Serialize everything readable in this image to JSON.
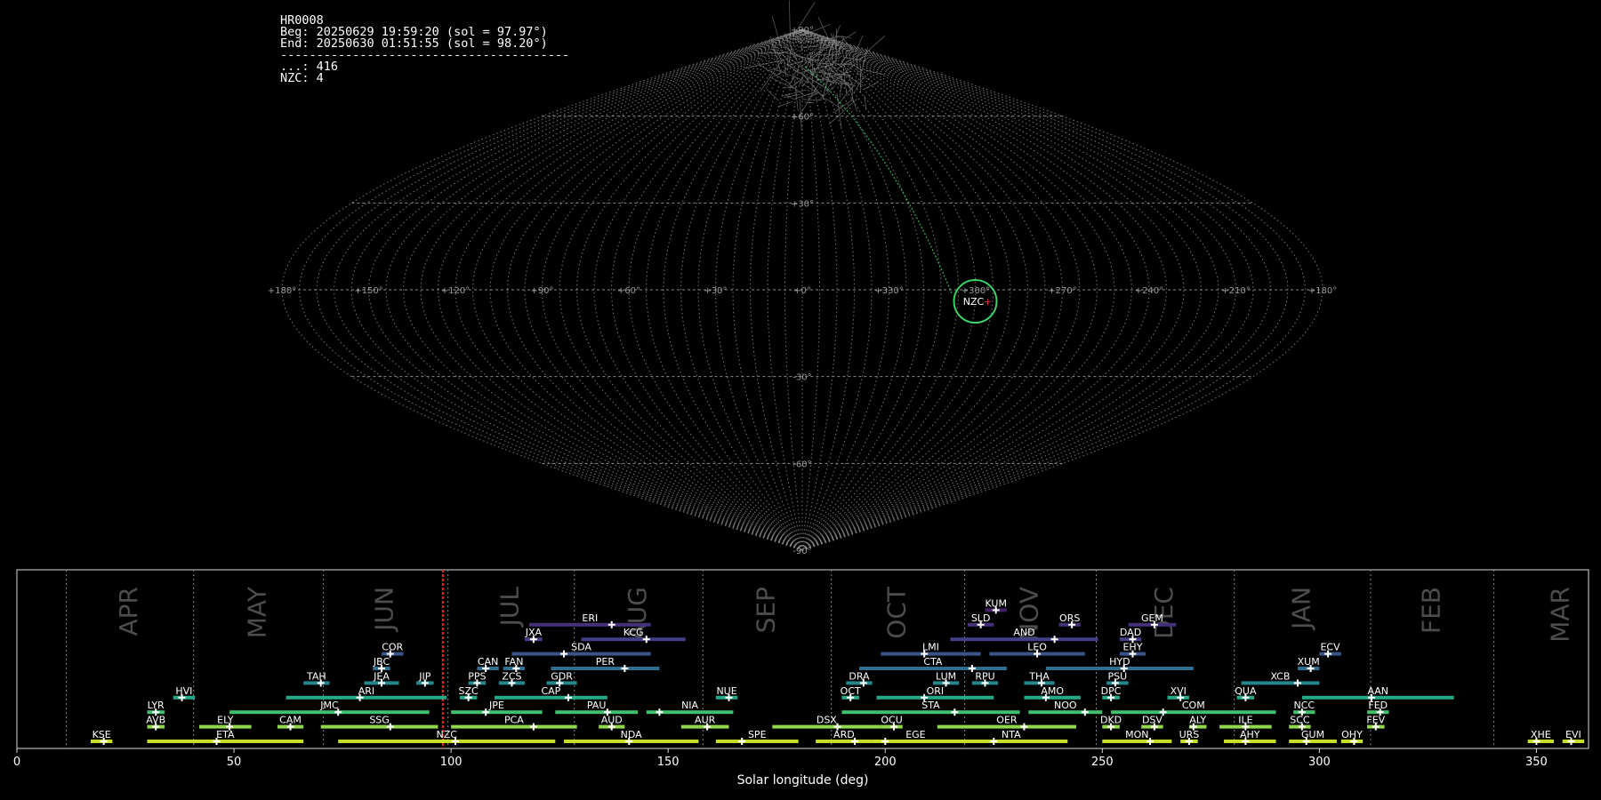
{
  "info": {
    "station": "HR0008",
    "begin": "Beg: 20250629 19:59:20 (sol = 97.97°)",
    "end": "End: 20250630 01:51:55 (sol = 98.20°)",
    "divider": "----------------------------------------",
    "count_line": "...: 416",
    "nzc_line": "NZC: 4"
  },
  "chart_data": [
    {
      "type": "scatter",
      "name": "sky-map",
      "projection": "sinusoidal",
      "lon_labels": [
        "+180°",
        "+150°",
        "+120°",
        "+90°",
        "+60°",
        "+30°",
        "+0°",
        "+330°",
        "+300°",
        "+270°",
        "+240°",
        "+210°",
        "+180°"
      ],
      "lat_labels": [
        "+90°",
        "+60°",
        "+30°",
        "-30°",
        "-60°",
        "-90°"
      ],
      "grid": true,
      "radiant": {
        "label": "NZC",
        "lon": 300,
        "lat": -4,
        "color": "#3ccf6a"
      },
      "trails_count": 416
    },
    {
      "type": "bar",
      "name": "shower-activity",
      "xlabel": "Solar longitude (deg)",
      "xlim": [
        0,
        362
      ],
      "xticks": [
        0,
        50,
        100,
        150,
        200,
        250,
        300,
        350
      ],
      "current_sol": 98.1,
      "months": [
        {
          "name": "APR",
          "start": 11.4
        },
        {
          "name": "MAY",
          "start": 40.7
        },
        {
          "name": "JUN",
          "start": 70.6
        },
        {
          "name": "JUL",
          "start": 99.3
        },
        {
          "name": "AUG",
          "start": 128.4
        },
        {
          "name": "SEP",
          "start": 158.0
        },
        {
          "name": "OCT",
          "start": 187.6
        },
        {
          "name": "NOV",
          "start": 218.3
        },
        {
          "name": "DEC",
          "start": 248.6
        },
        {
          "name": "JAN",
          "start": 280.4
        },
        {
          "name": "FEB",
          "start": 311.8
        },
        {
          "name": "MAR",
          "start": 340.2
        }
      ],
      "showers": [
        {
          "code": "KUM",
          "row": 10,
          "start": 223,
          "end": 228,
          "peak": 225.5
        },
        {
          "code": "ERI",
          "row": 9,
          "start": 118,
          "end": 146,
          "peak": 137
        },
        {
          "code": "SLD",
          "row": 9,
          "start": 219,
          "end": 225,
          "peak": 222
        },
        {
          "code": "ORS",
          "row": 9,
          "start": 240,
          "end": 245,
          "peak": 243
        },
        {
          "code": "GEM",
          "row": 9,
          "start": 256,
          "end": 267,
          "peak": 262
        },
        {
          "code": "JXA",
          "row": 8,
          "start": 117,
          "end": 121,
          "peak": 119
        },
        {
          "code": "KCG",
          "row": 8,
          "start": 130,
          "end": 154,
          "peak": 145
        },
        {
          "code": "AND",
          "row": 8,
          "start": 215,
          "end": 249,
          "peak": 239
        },
        {
          "code": "DAD",
          "row": 8,
          "start": 254,
          "end": 259,
          "peak": 257
        },
        {
          "code": "COR",
          "row": 7,
          "start": 84,
          "end": 89,
          "peak": 86
        },
        {
          "code": "SDA",
          "row": 7,
          "start": 114,
          "end": 146,
          "peak": 126
        },
        {
          "code": "LMI",
          "row": 7,
          "start": 199,
          "end": 222,
          "peak": 209
        },
        {
          "code": "LEO",
          "row": 7,
          "start": 224,
          "end": 246,
          "peak": 235
        },
        {
          "code": "EHY",
          "row": 7,
          "start": 254,
          "end": 260,
          "peak": 257
        },
        {
          "code": "ECV",
          "row": 7,
          "start": 300,
          "end": 305,
          "peak": 302
        },
        {
          "code": "JBC",
          "row": 6,
          "start": 82,
          "end": 86,
          "peak": 84
        },
        {
          "code": "CAN",
          "row": 6,
          "start": 106,
          "end": 111,
          "peak": 108
        },
        {
          "code": "FAN",
          "row": 6,
          "start": 112,
          "end": 117,
          "peak": 115
        },
        {
          "code": "PER",
          "row": 6,
          "start": 123,
          "end": 148,
          "peak": 140
        },
        {
          "code": "CTA",
          "row": 6,
          "start": 194,
          "end": 228,
          "peak": 220
        },
        {
          "code": "HYD",
          "row": 6,
          "start": 237,
          "end": 271,
          "peak": 255
        },
        {
          "code": "XUM",
          "row": 6,
          "start": 295,
          "end": 300,
          "peak": 298
        },
        {
          "code": "TAH",
          "row": 5,
          "start": 66,
          "end": 72,
          "peak": 70
        },
        {
          "code": "JEA",
          "row": 5,
          "start": 80,
          "end": 88,
          "peak": 84
        },
        {
          "code": "JIP",
          "row": 5,
          "start": 92,
          "end": 96,
          "peak": 94
        },
        {
          "code": "PPS",
          "row": 5,
          "start": 104,
          "end": 108,
          "peak": 106
        },
        {
          "code": "ZCS",
          "row": 5,
          "start": 111,
          "end": 117,
          "peak": 114
        },
        {
          "code": "GDR",
          "row": 5,
          "start": 122,
          "end": 129,
          "peak": 125
        },
        {
          "code": "DRA",
          "row": 5,
          "start": 191,
          "end": 197,
          "peak": 195
        },
        {
          "code": "LUM",
          "row": 5,
          "start": 211,
          "end": 217,
          "peak": 214
        },
        {
          "code": "RPU",
          "row": 5,
          "start": 220,
          "end": 226,
          "peak": 223
        },
        {
          "code": "THA",
          "row": 5,
          "start": 232,
          "end": 239,
          "peak": 236
        },
        {
          "code": "PSU",
          "row": 5,
          "start": 251,
          "end": 256,
          "peak": 253
        },
        {
          "code": "XCB",
          "row": 5,
          "start": 282,
          "end": 300,
          "peak": 295
        },
        {
          "code": "HVI",
          "row": 4,
          "start": 36,
          "end": 41,
          "peak": 38
        },
        {
          "code": "ARI",
          "row": 4,
          "start": 62,
          "end": 99,
          "peak": 79
        },
        {
          "code": "SZC",
          "row": 4,
          "start": 102,
          "end": 106,
          "peak": 104
        },
        {
          "code": "CAP",
          "row": 4,
          "start": 110,
          "end": 136,
          "peak": 127
        },
        {
          "code": "NUE",
          "row": 4,
          "start": 161,
          "end": 166,
          "peak": 164
        },
        {
          "code": "OCT",
          "row": 4,
          "start": 190,
          "end": 194,
          "peak": 192
        },
        {
          "code": "ORI",
          "row": 4,
          "start": 198,
          "end": 225,
          "peak": 209
        },
        {
          "code": "AMO",
          "row": 4,
          "start": 232,
          "end": 245,
          "peak": 237
        },
        {
          "code": "DPC",
          "row": 4,
          "start": 250,
          "end": 254,
          "peak": 252
        },
        {
          "code": "XVI",
          "row": 4,
          "start": 265,
          "end": 270,
          "peak": 268
        },
        {
          "code": "QUA",
          "row": 4,
          "start": 281,
          "end": 285,
          "peak": 283
        },
        {
          "code": "AAN",
          "row": 4,
          "start": 296,
          "end": 331,
          "peak": 312
        },
        {
          "code": "LYR",
          "row": 3,
          "start": 30,
          "end": 34,
          "peak": 32
        },
        {
          "code": "JMC",
          "row": 3,
          "start": 49,
          "end": 95,
          "peak": 74
        },
        {
          "code": "JPE",
          "row": 3,
          "start": 100,
          "end": 121,
          "peak": 108
        },
        {
          "code": "PAU",
          "row": 3,
          "start": 124,
          "end": 143,
          "peak": 136
        },
        {
          "code": "NIA",
          "row": 3,
          "start": 145,
          "end": 165,
          "peak": 148
        },
        {
          "code": "STA",
          "row": 3,
          "start": 190,
          "end": 231,
          "peak": 216
        },
        {
          "code": "NOO",
          "row": 3,
          "start": 233,
          "end": 250,
          "peak": 246
        },
        {
          "code": "COM",
          "row": 3,
          "start": 252,
          "end": 290,
          "peak": 264
        },
        {
          "code": "NCC",
          "row": 3,
          "start": 294,
          "end": 299,
          "peak": 296
        },
        {
          "code": "FED",
          "row": 3,
          "start": 311,
          "end": 316,
          "peak": 314
        },
        {
          "code": "AVB",
          "row": 2,
          "start": 30,
          "end": 34,
          "peak": 32
        },
        {
          "code": "ELY",
          "row": 2,
          "start": 42,
          "end": 54,
          "peak": 49
        },
        {
          "code": "CAM",
          "row": 2,
          "start": 60,
          "end": 66,
          "peak": 63
        },
        {
          "code": "SSG",
          "row": 2,
          "start": 70,
          "end": 97,
          "peak": 86
        },
        {
          "code": "PCA",
          "row": 2,
          "start": 100,
          "end": 129,
          "peak": 119
        },
        {
          "code": "AUD",
          "row": 2,
          "start": 134,
          "end": 140,
          "peak": 137
        },
        {
          "code": "AUR",
          "row": 2,
          "start": 153,
          "end": 164,
          "peak": 159
        },
        {
          "code": "DSX",
          "row": 2,
          "start": 174,
          "end": 199,
          "peak": 189
        },
        {
          "code": "OCU",
          "row": 2,
          "start": 199,
          "end": 204,
          "peak": 202
        },
        {
          "code": "OER",
          "row": 2,
          "start": 212,
          "end": 244,
          "peak": 232
        },
        {
          "code": "DKD",
          "row": 2,
          "start": 250,
          "end": 254,
          "peak": 252
        },
        {
          "code": "DSV",
          "row": 2,
          "start": 259,
          "end": 264,
          "peak": 262
        },
        {
          "code": "ALY",
          "row": 2,
          "start": 270,
          "end": 274,
          "peak": 271
        },
        {
          "code": "ILE",
          "row": 2,
          "start": 277,
          "end": 289,
          "peak": 283
        },
        {
          "code": "SCC",
          "row": 2,
          "start": 293,
          "end": 298,
          "peak": 296
        },
        {
          "code": "FEV",
          "row": 2,
          "start": 311,
          "end": 315,
          "peak": 313
        },
        {
          "code": "KSE",
          "row": 1,
          "start": 17,
          "end": 22,
          "peak": 20
        },
        {
          "code": "ETA",
          "row": 1,
          "start": 30,
          "end": 66,
          "peak": 46
        },
        {
          "code": "NZC",
          "row": 1,
          "start": 74,
          "end": 124,
          "peak": 101
        },
        {
          "code": "NDA",
          "row": 1,
          "start": 126,
          "end": 157,
          "peak": 141
        },
        {
          "code": "SPE",
          "row": 1,
          "start": 161,
          "end": 180,
          "peak": 167
        },
        {
          "code": "ARD",
          "row": 1,
          "start": 184,
          "end": 197,
          "peak": 193
        },
        {
          "code": "EGE",
          "row": 1,
          "start": 197,
          "end": 217,
          "peak": 200
        },
        {
          "code": "NTA",
          "row": 1,
          "start": 216,
          "end": 242,
          "peak": 225
        },
        {
          "code": "MON",
          "row": 1,
          "start": 250,
          "end": 266,
          "peak": 261
        },
        {
          "code": "URS",
          "row": 1,
          "start": 268,
          "end": 272,
          "peak": 270
        },
        {
          "code": "AHY",
          "row": 1,
          "start": 278,
          "end": 290,
          "peak": 283
        },
        {
          "code": "GUM",
          "row": 1,
          "start": 293,
          "end": 304,
          "peak": 297
        },
        {
          "code": "OHY",
          "row": 1,
          "start": 305,
          "end": 310,
          "peak": 308
        },
        {
          "code": "XHE",
          "row": 1,
          "start": 348,
          "end": 354,
          "peak": 350
        },
        {
          "code": "EVI",
          "row": 1,
          "start": 356,
          "end": 361,
          "peak": 358
        }
      ]
    }
  ]
}
